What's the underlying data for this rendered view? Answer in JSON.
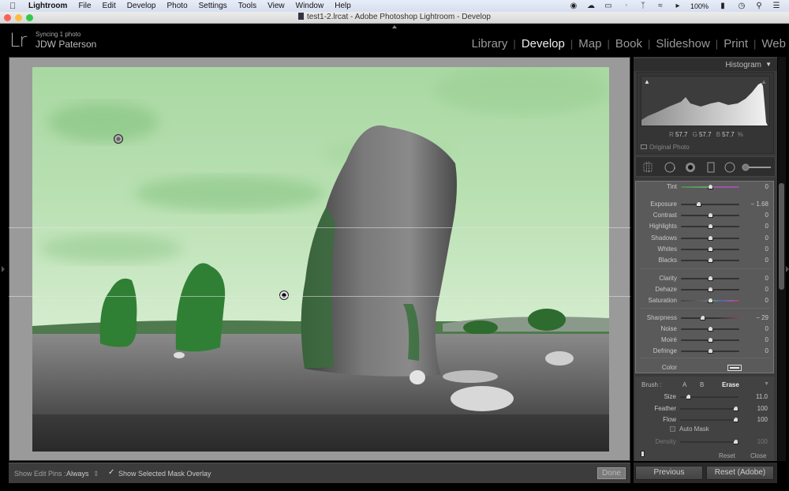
{
  "menubar": {
    "apple": "",
    "items": [
      "Lightroom",
      "File",
      "Edit",
      "Develop",
      "Photo",
      "Settings",
      "Tools",
      "View",
      "Window",
      "Help"
    ],
    "status": {
      "battery": "100%",
      "icons": [
        "shield-icon",
        "cloud-icon",
        "airplay-icon",
        "time-machine-icon",
        "bluetooth-icon",
        "wifi-icon",
        "volume-icon",
        "battery-icon",
        "clock-icon",
        "spotlight-icon",
        "notification-icon"
      ]
    }
  },
  "window": {
    "title": "test1-2.lrcat - Adobe Photoshop Lightroom - Develop"
  },
  "identity": {
    "logo": "Lr",
    "status": "Syncing 1 photo",
    "name": "JDW Paterson"
  },
  "modules": {
    "items": [
      "Library",
      "Develop",
      "Map",
      "Book",
      "Slideshow",
      "Print",
      "Web"
    ],
    "active": "Develop"
  },
  "histogram": {
    "title": "Histogram",
    "r_label": "R",
    "r": "57.7",
    "g_label": "G",
    "g": "57.7",
    "b_label": "B",
    "b": "57.7",
    "unit": "%",
    "original_photo": "Original Photo"
  },
  "adjustments": {
    "tint": {
      "label": "Tint",
      "value": "0",
      "pos": 0.5
    },
    "exposure": {
      "label": "Exposure",
      "value": "− 1.68",
      "pos": 0.3
    },
    "contrast": {
      "label": "Contrast",
      "value": "0",
      "pos": 0.5
    },
    "highlights": {
      "label": "Highlights",
      "value": "0",
      "pos": 0.5
    },
    "shadows": {
      "label": "Shadows",
      "value": "0",
      "pos": 0.5
    },
    "whites": {
      "label": "Whites",
      "value": "0",
      "pos": 0.5
    },
    "blacks": {
      "label": "Blacks",
      "value": "0",
      "pos": 0.5
    },
    "clarity": {
      "label": "Clarity",
      "value": "0",
      "pos": 0.5
    },
    "dehaze": {
      "label": "Dehaze",
      "value": "0",
      "pos": 0.5
    },
    "saturation": {
      "label": "Saturation",
      "value": "0",
      "pos": 0.5
    },
    "sharpness": {
      "label": "Sharpness",
      "value": "− 29",
      "pos": 0.37
    },
    "noise": {
      "label": "Noise",
      "value": "0",
      "pos": 0.5
    },
    "moire": {
      "label": "Moiré",
      "value": "0",
      "pos": 0.5
    },
    "defringe": {
      "label": "Defringe",
      "value": "0",
      "pos": 0.5
    },
    "color": {
      "label": "Color"
    }
  },
  "brush": {
    "label": "Brush :",
    "a": "A",
    "b": "B",
    "erase": "Erase",
    "size": {
      "label": "Size",
      "value": "11.0",
      "pos": 0.14
    },
    "feather": {
      "label": "Feather",
      "value": "100",
      "pos": 0.95
    },
    "flow": {
      "label": "Flow",
      "value": "100",
      "pos": 0.95
    },
    "auto_mask": "Auto Mask",
    "density": {
      "label": "Density",
      "value": "100",
      "pos": 0.95
    },
    "reset": "Reset",
    "close": "Close"
  },
  "toolbar": {
    "show_edit_pins_label": "Show Edit Pins :",
    "show_edit_pins_value": "Always",
    "overlay_label": "Show Selected Mask Overlay",
    "overlay_checked": true,
    "done": "Done"
  },
  "panel_buttons": {
    "previous": "Previous",
    "reset": "Reset (Adobe)"
  },
  "colors": {
    "mask_overlay": "#8fd38a",
    "panel_bg": "#3a3a3a",
    "active_module": "#eeeeee"
  }
}
